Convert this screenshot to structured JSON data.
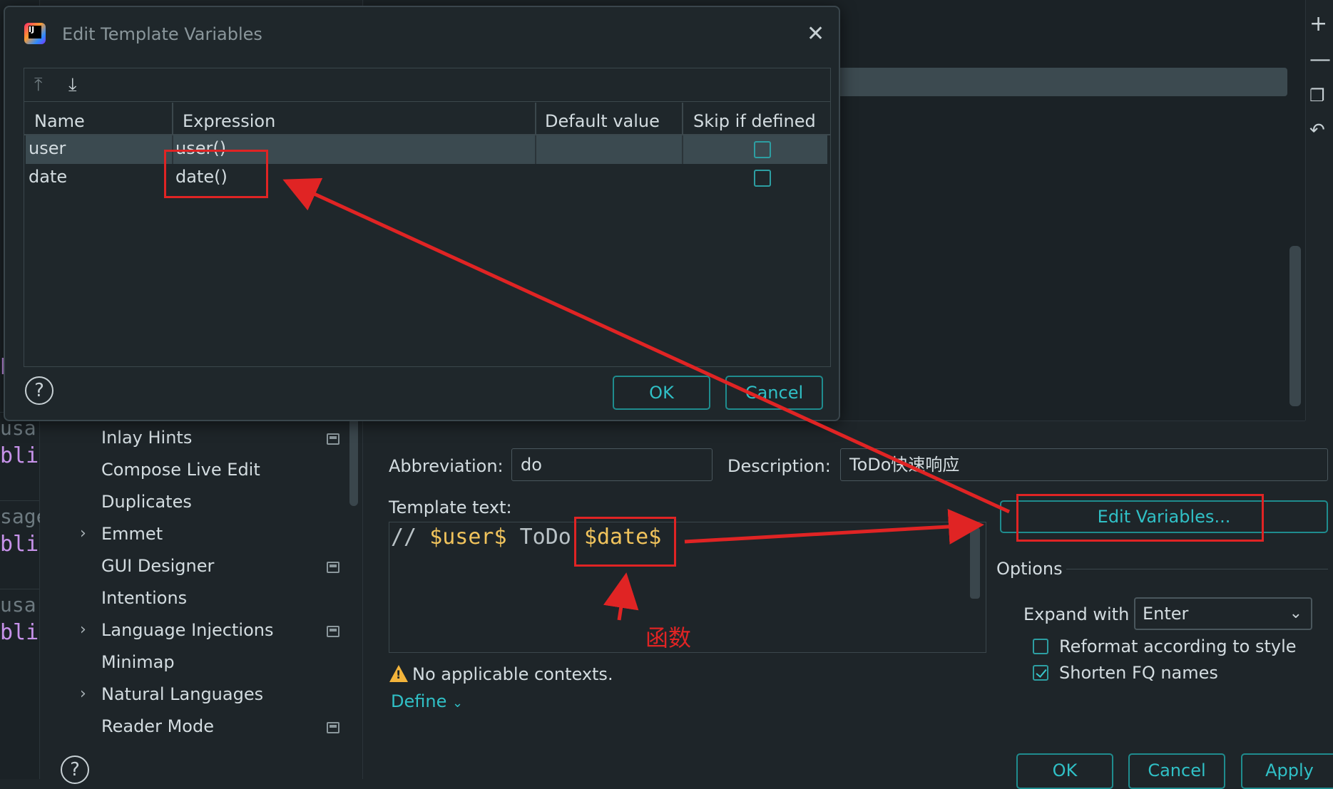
{
  "editor": {
    "fragments": [
      "bli",
      "usa",
      "bli",
      "sage",
      "bli",
      "usa",
      "bli"
    ]
  },
  "settings_tree": {
    "items": [
      {
        "label": "Inlay Hints",
        "chevron": false,
        "badge": true
      },
      {
        "label": "Compose Live Edit",
        "chevron": false,
        "badge": false
      },
      {
        "label": "Duplicates",
        "chevron": false,
        "badge": false
      },
      {
        "label": "Emmet",
        "chevron": true,
        "badge": false
      },
      {
        "label": "GUI Designer",
        "chevron": false,
        "badge": true
      },
      {
        "label": "Intentions",
        "chevron": false,
        "badge": false
      },
      {
        "label": "Language Injections",
        "chevron": true,
        "badge": true
      },
      {
        "label": "Minimap",
        "chevron": false,
        "badge": false
      },
      {
        "label": "Natural Languages",
        "chevron": true,
        "badge": false
      },
      {
        "label": "Reader Mode",
        "chevron": false,
        "badge": true
      }
    ],
    "help_label": "?"
  },
  "toolbar_icons": [
    "plus-icon",
    "minus-icon",
    "copy-icon",
    "undo-icon"
  ],
  "template_editor": {
    "abbreviation_label": "Abbreviation:",
    "abbreviation_value": "do",
    "description_label": "Description:",
    "description_value": "ToDo快速响应",
    "template_text_label": "Template text:",
    "template_text": {
      "prefix": "// ",
      "var_user": "$user$",
      "middle": " ToDo ",
      "var_date": "$date$"
    },
    "edit_variables_button": "Edit Variables...",
    "options_title": "Options",
    "expand_with_label": "Expand with",
    "expand_with_value": "Enter",
    "reformat_label": "Reformat according to style",
    "reformat_checked": false,
    "shorten_label": "Shorten FQ names",
    "shorten_checked": true,
    "warning_text": "No applicable contexts.",
    "define_link": "Define",
    "buttons": {
      "ok": "OK",
      "cancel": "Cancel",
      "apply": "Apply"
    }
  },
  "dialog": {
    "title": "Edit Template Variables",
    "columns": [
      "Name",
      "Expression",
      "Default value",
      "Skip if defined"
    ],
    "rows": [
      {
        "name": "user",
        "expression": "user()",
        "default_value": "",
        "skip_if_defined": false
      },
      {
        "name": "date",
        "expression": "date()",
        "default_value": "",
        "skip_if_defined": false
      }
    ],
    "ok_label": "OK",
    "cancel_label": "Cancel",
    "help_label": "?"
  },
  "annotations": {
    "function_label": "函数",
    "color": "#e02424"
  },
  "colors": {
    "accent": "#30c0c6",
    "variable": "#f0c35c",
    "background": "#1e2529"
  }
}
